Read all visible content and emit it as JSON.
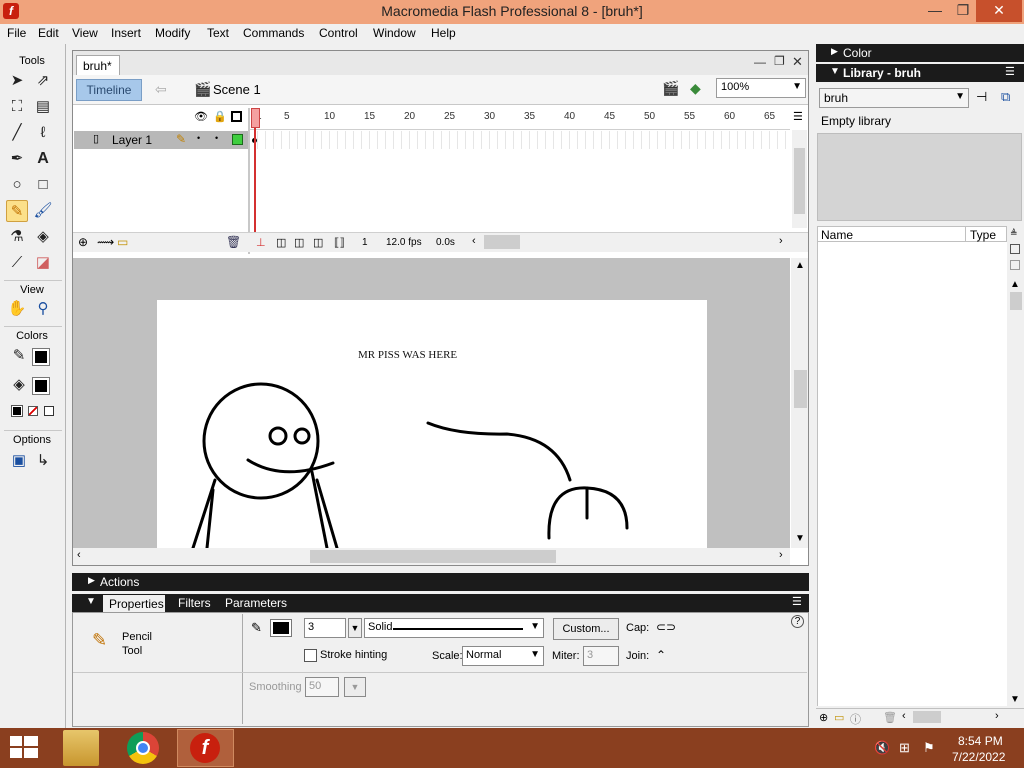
{
  "window": {
    "title": "Macromedia Flash Professional 8 - [bruh*]",
    "logo_glyph": "f",
    "min_glyph": "—",
    "restore_glyph": "❐",
    "close_glyph": "✕"
  },
  "menu": [
    "File",
    "Edit",
    "View",
    "Insert",
    "Modify",
    "Text",
    "Commands",
    "Control",
    "Window",
    "Help"
  ],
  "tools": {
    "title": "Tools",
    "view_title": "View",
    "colors_title": "Colors",
    "options_title": "Options"
  },
  "document": {
    "tab_label": "bruh*",
    "timeline_button": "Timeline",
    "scene_label": "Scene 1",
    "zoom_value": "100%"
  },
  "timeline": {
    "layer_name": "Layer 1",
    "frame_numbers": [
      "1",
      "5",
      "10",
      "15",
      "20",
      "25",
      "30",
      "35",
      "40",
      "45",
      "50",
      "55",
      "60",
      "65"
    ],
    "current_frame": "1",
    "fps": "12.0 fps",
    "elapsed": "0.0s"
  },
  "stage": {
    "text": "MR PISS WAS HERE"
  },
  "panels": {
    "actions_title": "Actions",
    "tabs": [
      "Properties",
      "Filters",
      "Parameters"
    ]
  },
  "properties": {
    "tool_name_line1": "Pencil",
    "tool_name_line2": "Tool",
    "stroke_size": "3",
    "stroke_style": "Solid",
    "custom_button": "Custom...",
    "cap_label": "Cap:",
    "stroke_hinting_label": "Stroke hinting",
    "scale_label": "Scale:",
    "scale_value": "Normal",
    "miter_label": "Miter:",
    "miter_value": "3",
    "join_label": "Join:",
    "smoothing_label": "Smoothing",
    "smoothing_value": "50",
    "help_glyph": "?"
  },
  "right_panels": {
    "color_title": "Color",
    "library_title": "Library - bruh",
    "library_select": "bruh",
    "library_status": "Empty library",
    "col_name": "Name",
    "col_type": "Type"
  },
  "taskbar": {
    "time": "8:54 PM",
    "date": "7/22/2022"
  },
  "colors": {
    "title_bar": "#f0a37c",
    "taskbar": "#8a3f1f",
    "timeline_button": "#a7c8ea",
    "panel_header": "#1b1b1b",
    "flash_red": "#c8200e"
  }
}
